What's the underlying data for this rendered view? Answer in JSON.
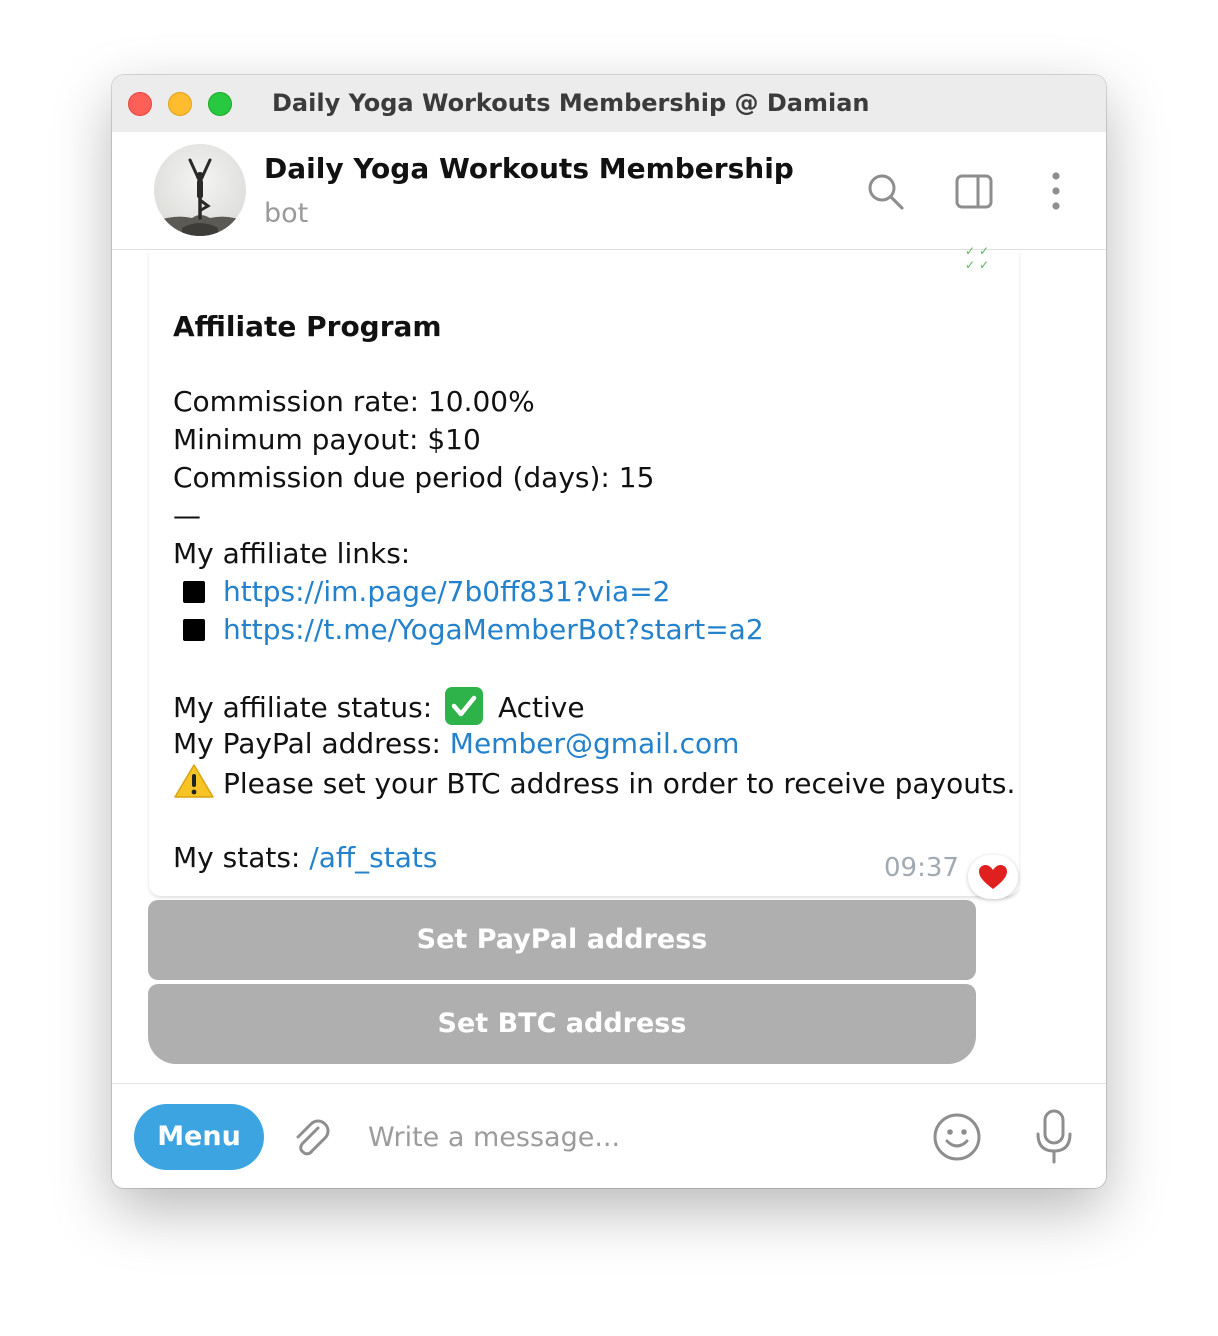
{
  "window": {
    "title": "Daily Yoga Workouts Membership @ Damian"
  },
  "header": {
    "chat_name": "Daily Yoga Workouts Membership",
    "subtitle": "bot"
  },
  "message": {
    "heading": "Affiliate Program",
    "commission_rate": "Commission rate: 10.00%",
    "minimum_payout": "Minimum payout: $10",
    "due_period": "Commission due period (days): 15",
    "separator": "—",
    "links_label": "My affiliate links:",
    "links": [
      "https://im.page/7b0ff831?via=2",
      "https://t.me/YogaMemberBot?start=a2"
    ],
    "status_label": "My affiliate status:",
    "status_value": "Active",
    "paypal_label": "My PayPal address:",
    "paypal_value": "Member@gmail.com",
    "btc_warning": "Please set your BTC address in order to receive payouts.",
    "stats_label": "My stats:",
    "stats_command": "/aff_stats",
    "time": "09:37",
    "reaction_icon": "red-heart"
  },
  "keyboard": {
    "buttons": [
      "Set PayPal address",
      "Set BTC address"
    ]
  },
  "composer": {
    "menu_label": "Menu",
    "placeholder": "Write a message..."
  },
  "colors": {
    "link": "#2481cc",
    "menu_button": "#3ca5e1",
    "keyboard_button": "#afafaf",
    "status_check": "#2eb34a"
  }
}
